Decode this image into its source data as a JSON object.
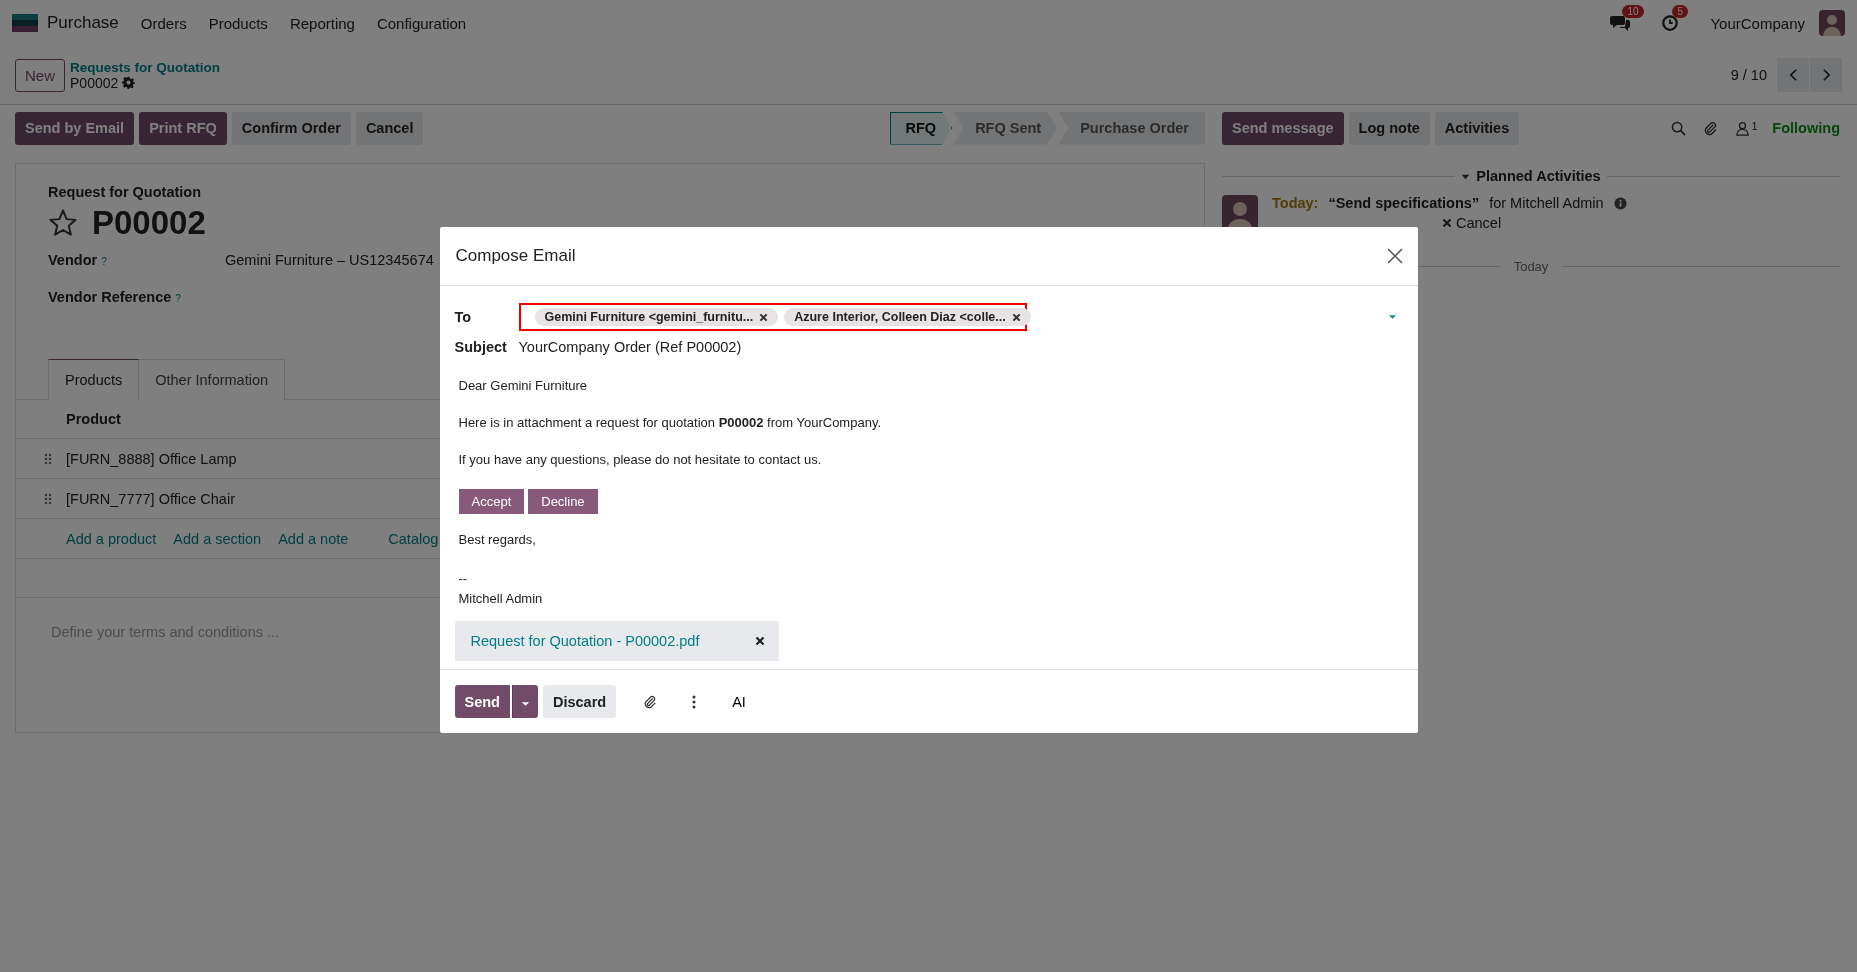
{
  "navbar": {
    "app_name": "Purchase",
    "menu": [
      "Orders",
      "Products",
      "Reporting",
      "Configuration"
    ],
    "notifications": [
      {
        "kind": "messages",
        "count": "10"
      },
      {
        "kind": "activities",
        "count": "5"
      }
    ],
    "company": "YourCompany"
  },
  "control_panel": {
    "new_button": "New",
    "breadcrumb": "Requests for Quotation",
    "record": "P00002",
    "pager": "9 / 10"
  },
  "actions": [
    {
      "label": "Send by Email",
      "kind": "primary"
    },
    {
      "label": "Print RFQ",
      "kind": "primary"
    },
    {
      "label": "Confirm Order",
      "kind": "secondary"
    },
    {
      "label": "Cancel",
      "kind": "secondary"
    }
  ],
  "statusbar": [
    {
      "label": "RFQ",
      "selected": true
    },
    {
      "label": "RFQ Sent",
      "selected": false
    },
    {
      "label": "Purchase Order",
      "selected": false
    }
  ],
  "chatter_buttons": [
    {
      "label": "Send message",
      "kind": "primary"
    },
    {
      "label": "Log note",
      "kind": "secondary"
    },
    {
      "label": "Activities",
      "kind": "secondary"
    }
  ],
  "followers": {
    "count": "1",
    "following": "Following"
  },
  "form": {
    "title_label": "Request for Quotation",
    "starred": false,
    "name": "P00002",
    "fields": [
      {
        "label": "Vendor",
        "help": "?",
        "value": "Gemini Furniture – US12345674"
      },
      {
        "label": "Vendor Reference",
        "help": "?"
      }
    ],
    "tabs": [
      {
        "label": "Products",
        "selected": true
      },
      {
        "label": "Other Information",
        "selected": false
      }
    ],
    "lines": {
      "header": "Product",
      "rows": [
        "[FURN_8888] Office Lamp",
        "[FURN_7777] Office Chair"
      ],
      "add_links": [
        "Add a product",
        "Add a section",
        "Add a note"
      ],
      "catalog": "Catalog"
    },
    "terms_placeholder": "Define your terms and conditions ..."
  },
  "chatter": {
    "section": "Planned Activities",
    "expanded": true,
    "activity": {
      "due": "Today:",
      "summary": "“Send specifications”",
      "assignee": "for Mitchell Admin",
      "cancel": "Cancel"
    },
    "separator": "Today"
  },
  "dialog": {
    "title": "Compose Email",
    "to_label": "To",
    "recipients": [
      "Gemini Furniture <gemini_furnitu...",
      "Azure Interior, Colleen Diaz <colle..."
    ],
    "subject_label": "Subject",
    "subject": "YourCompany Order (Ref P00002)",
    "body": {
      "greeting": "Dear Gemini Furniture",
      "paragraph": "Here is in attachment a request for quotation **P00002** from YourCompany.",
      "questions": "If you have any questions, please do not hesitate to contact us.",
      "buttons": [
        "Accept",
        "Decline"
      ],
      "closing": "Best regards,",
      "signature_sep": "--",
      "signature": "Mitchell Admin"
    },
    "attachment": "Request for Quotation - P00002.pdf",
    "footer": {
      "send": "Send",
      "discard": "Discard",
      "ai": "AI"
    }
  }
}
